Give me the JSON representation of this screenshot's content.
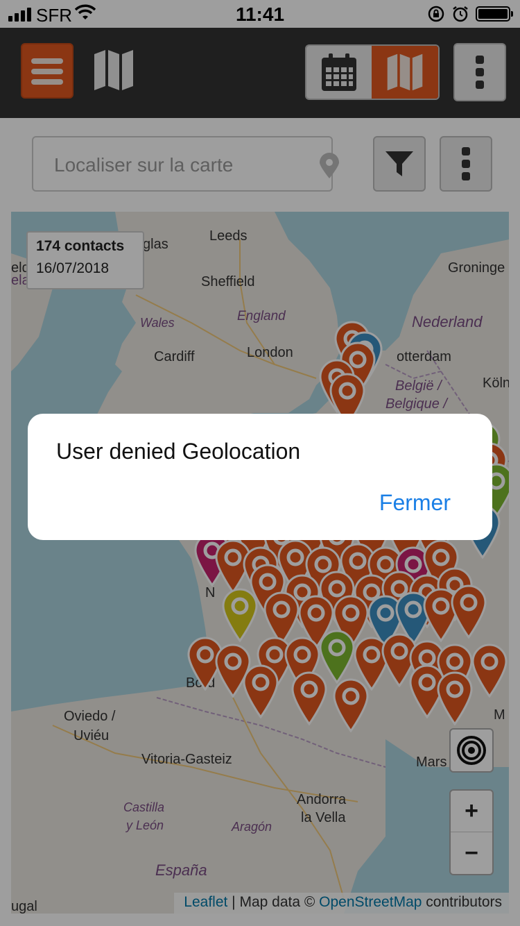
{
  "status_bar": {
    "carrier": "SFR",
    "time": "11:41"
  },
  "app_bar": {
    "menu_icon": "hamburger-icon",
    "title_icon": "map-icon",
    "view_toggle": {
      "calendar_icon": "calendar-icon",
      "map_icon": "map-icon",
      "active": "map"
    },
    "more_icon": "vertical-dots-icon"
  },
  "search": {
    "placeholder": "Localiser sur la carte",
    "value": ""
  },
  "map": {
    "contacts_count": "174 contacts",
    "date": "16/07/2018",
    "labels": {
      "leeds": "Leeds",
      "glas": "glas",
      "sheffield": "Sheffield",
      "groning": "Groninge",
      "wales": "Wales",
      "england": "England",
      "nederland": "Nederland",
      "cardiff": "Cardiff",
      "london": "London",
      "rotterdam": "otterdam",
      "kol": "Köln",
      "belgie": "België /",
      "belgique": "Belgique /",
      "bord": "Bord",
      "oviedo": "Oviedo /",
      "uvieu": "Uviéu",
      "vitoria": "Vitoria-Gasteiz",
      "mars": "Mars",
      "andorra1": "Andorra",
      "andorra2": "la Vella",
      "castilla1": "Castilla",
      "castilla2": "y León",
      "aragon": "Aragón",
      "espana": "España",
      "ela": "ela",
      "eld": "eld",
      "ugal": "ugal",
      "na": "N",
      "m": "M"
    },
    "locate_icon": "target-icon",
    "zoom_in": "+",
    "zoom_out": "−",
    "attribution": {
      "leaflet": "Leaflet",
      "sep": " | Map data © ",
      "osm": "OpenStreetMap",
      "tail": " contributors"
    },
    "marker_colors": {
      "orange": "#e0571f",
      "green": "#7cb82f",
      "blue": "#3d8fc2",
      "yellow": "#d6c91a",
      "magenta": "#c7226f"
    }
  },
  "dialog": {
    "message": "User denied Geolocation",
    "close_label": "Fermer"
  }
}
